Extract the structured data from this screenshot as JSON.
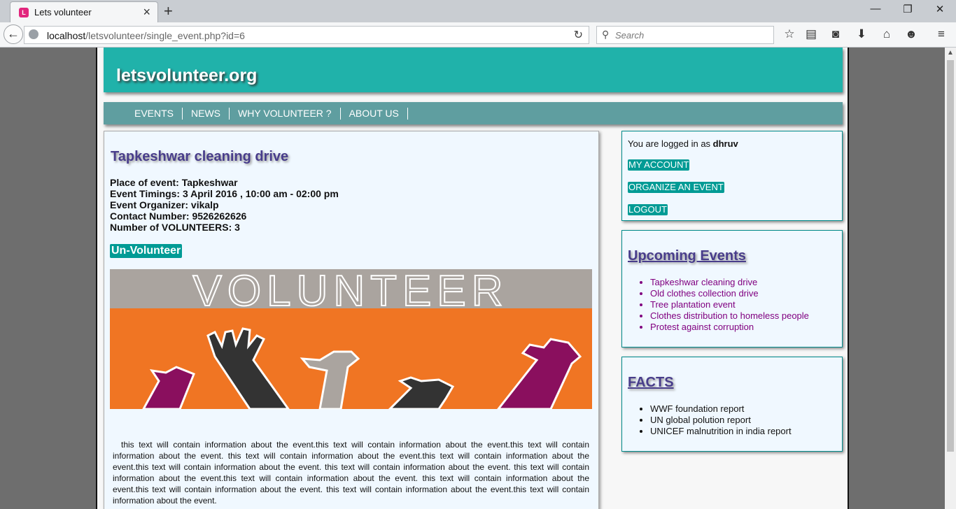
{
  "browser": {
    "tab_title": "Lets volunteer",
    "url_host": "localhost",
    "url_path": "/letsvolunteer/single_event.php?id=6",
    "search_placeholder": "Search"
  },
  "site": {
    "name": "letsvolunteer.org",
    "nav": [
      "EVENTS",
      "NEWS",
      "WHY VOLUNTEER ?",
      "ABOUT US"
    ]
  },
  "event": {
    "title": "Tapkeshwar cleaning drive",
    "details": [
      "Place of event: Tapkeshwar",
      "Event Timings: 3 April 2016 , 10:00 am - 02:00 pm",
      "Event Organizer: vikalp",
      "Contact Number: 9526262626",
      "Number of VOLUNTEERS: 3"
    ],
    "action_label": "Un-Volunteer",
    "banner_text": "VOLUNTEER",
    "description": "this text will contain information about the event.this text will contain information about the event.this text will contain information about the event. this text will contain information about the event.this text will contain information about the event.this text will contain information about the event. this text will contain information about the event. this text will contain information about the event.this text will contain information about the event. this text will contain information about the event.this text will contain information about the event. this text will contain information about the event.this text will contain information about the event."
  },
  "account": {
    "logged_in_prefix": "You are logged in as ",
    "username": "dhruv",
    "links": [
      "MY ACCOUNT",
      "ORGANIZE AN EVENT",
      "LOGOUT"
    ]
  },
  "upcoming": {
    "heading": "Upcoming Events",
    "items": [
      "Tapkeshwar cleaning drive",
      "Old clothes collection drive",
      "Tree plantation event",
      "Clothes distribution to homeless people",
      "Protest against corruption"
    ]
  },
  "facts": {
    "heading": "FACTS",
    "items": [
      "WWF foundation report",
      "UN global polution report",
      "UNICEF malnutrition in india report"
    ]
  },
  "colors": {
    "header": "#20b2aa",
    "nav": "#5f9ea0",
    "button": "#009b95",
    "heading": "#483d8b",
    "link": "#800080"
  },
  "icons": [
    "tab-favicon-icon",
    "close-tab-icon",
    "new-tab-icon",
    "minimize-icon",
    "maximize-icon",
    "window-close-icon",
    "back-icon",
    "globe-icon",
    "reload-icon",
    "search-icon",
    "bookmark-star-icon",
    "reading-list-icon",
    "pocket-icon",
    "download-icon",
    "home-icon",
    "smiley-icon",
    "hamburger-menu-icon"
  ]
}
